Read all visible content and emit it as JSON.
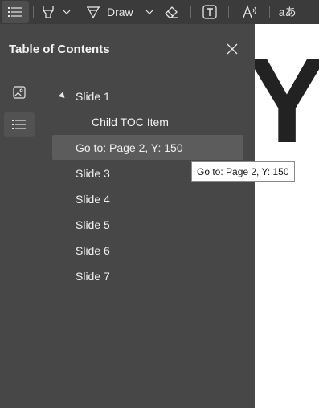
{
  "toolbar": {
    "items": [
      {
        "name": "table-of-contents",
        "icon": "list-icon",
        "active": true
      },
      {
        "name": "highlight",
        "icon": "highlighter-icon"
      },
      {
        "name": "draw",
        "icon": "pen-icon",
        "label": "Draw"
      },
      {
        "name": "erase",
        "icon": "eraser-icon"
      },
      {
        "name": "add-text",
        "icon": "text-box-icon"
      },
      {
        "name": "read-aloud",
        "icon": "read-aloud-icon"
      },
      {
        "name": "translate",
        "icon": "translate-icon",
        "label": "aあ"
      }
    ]
  },
  "toc_panel": {
    "title": "Table of Contents",
    "close_icon": "close-icon",
    "side_tabs": [
      {
        "name": "thumbnails",
        "icon": "image-icon",
        "active": false
      },
      {
        "name": "outline",
        "icon": "list-icon",
        "active": true
      }
    ],
    "items": [
      {
        "label": "Slide 1",
        "level": 0,
        "expanded": true
      },
      {
        "label": "Child TOC Item",
        "level": 1
      },
      {
        "label": "Go to: Page 2, Y: 150",
        "level": 0,
        "hovered": true
      },
      {
        "label": "Slide 3",
        "level": 0
      },
      {
        "label": "Slide 4",
        "level": 0
      },
      {
        "label": "Slide 5",
        "level": 0
      },
      {
        "label": "Slide 6",
        "level": 0
      },
      {
        "label": "Slide 7",
        "level": 0
      }
    ]
  },
  "tooltip": {
    "text": "Go to: Page 2, Y: 150"
  },
  "document": {
    "visible_text": "Y"
  },
  "colors": {
    "toolbar_bg": "#3b3b3b",
    "panel_bg": "#474747",
    "hover_bg": "#5c5c5c",
    "document_bg": "#ffffff",
    "text": "#f0f0f0"
  }
}
